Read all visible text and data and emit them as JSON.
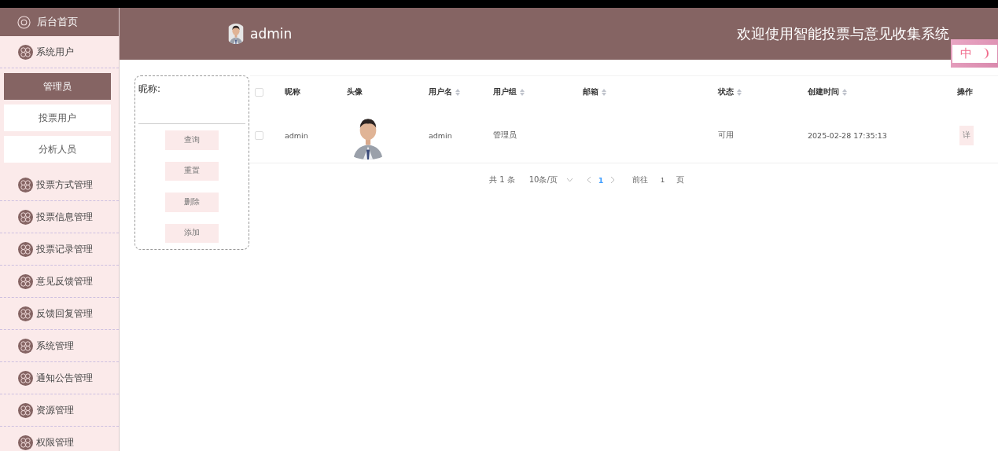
{
  "sidebar": {
    "home": {
      "label": "后台首页"
    },
    "items": [
      {
        "label": "系统用户",
        "children": [
          {
            "label": "管理员",
            "selected": true
          },
          {
            "label": "投票用户",
            "selected": false
          },
          {
            "label": "分析人员",
            "selected": false
          }
        ]
      },
      {
        "label": "投票方式管理"
      },
      {
        "label": "投票信息管理"
      },
      {
        "label": "投票记录管理"
      },
      {
        "label": "意见反馈管理"
      },
      {
        "label": "反馈回复管理"
      },
      {
        "label": "系统管理"
      },
      {
        "label": "通知公告管理"
      },
      {
        "label": "资源管理"
      },
      {
        "label": "权限管理"
      }
    ]
  },
  "header": {
    "user": "admin",
    "title": "欢迎使用智能投票与意见收集系统",
    "toggle": {
      "language": "中"
    }
  },
  "filter": {
    "field_label": "昵称:",
    "buttons": [
      "查询",
      "重置",
      "删除",
      "添加"
    ]
  },
  "table": {
    "all_checked": false,
    "columns": [
      {
        "label": "昵称",
        "sortable": false
      },
      {
        "label": "头像",
        "sortable": false
      },
      {
        "label": "用户名",
        "sortable": true
      },
      {
        "label": "用户组",
        "sortable": true
      },
      {
        "label": "邮箱",
        "sortable": true
      },
      {
        "label": "状态",
        "sortable": true
      },
      {
        "label": "创建时间",
        "sortable": true
      },
      {
        "label": "操作",
        "sortable": false
      }
    ],
    "rows": [
      {
        "checked": false,
        "nickname": "admin",
        "username": "admin",
        "group": "管理员",
        "status": "可用",
        "created": "2025-02-28 17:35:13",
        "action": "详"
      }
    ]
  },
  "pagination": {
    "total": "共 1 条",
    "page_size": "10条/页",
    "pages": [
      {
        "label": "1",
        "selected": true
      }
    ],
    "goto_label": "前往",
    "goto_value": "1",
    "goto_suffix": "页"
  }
}
